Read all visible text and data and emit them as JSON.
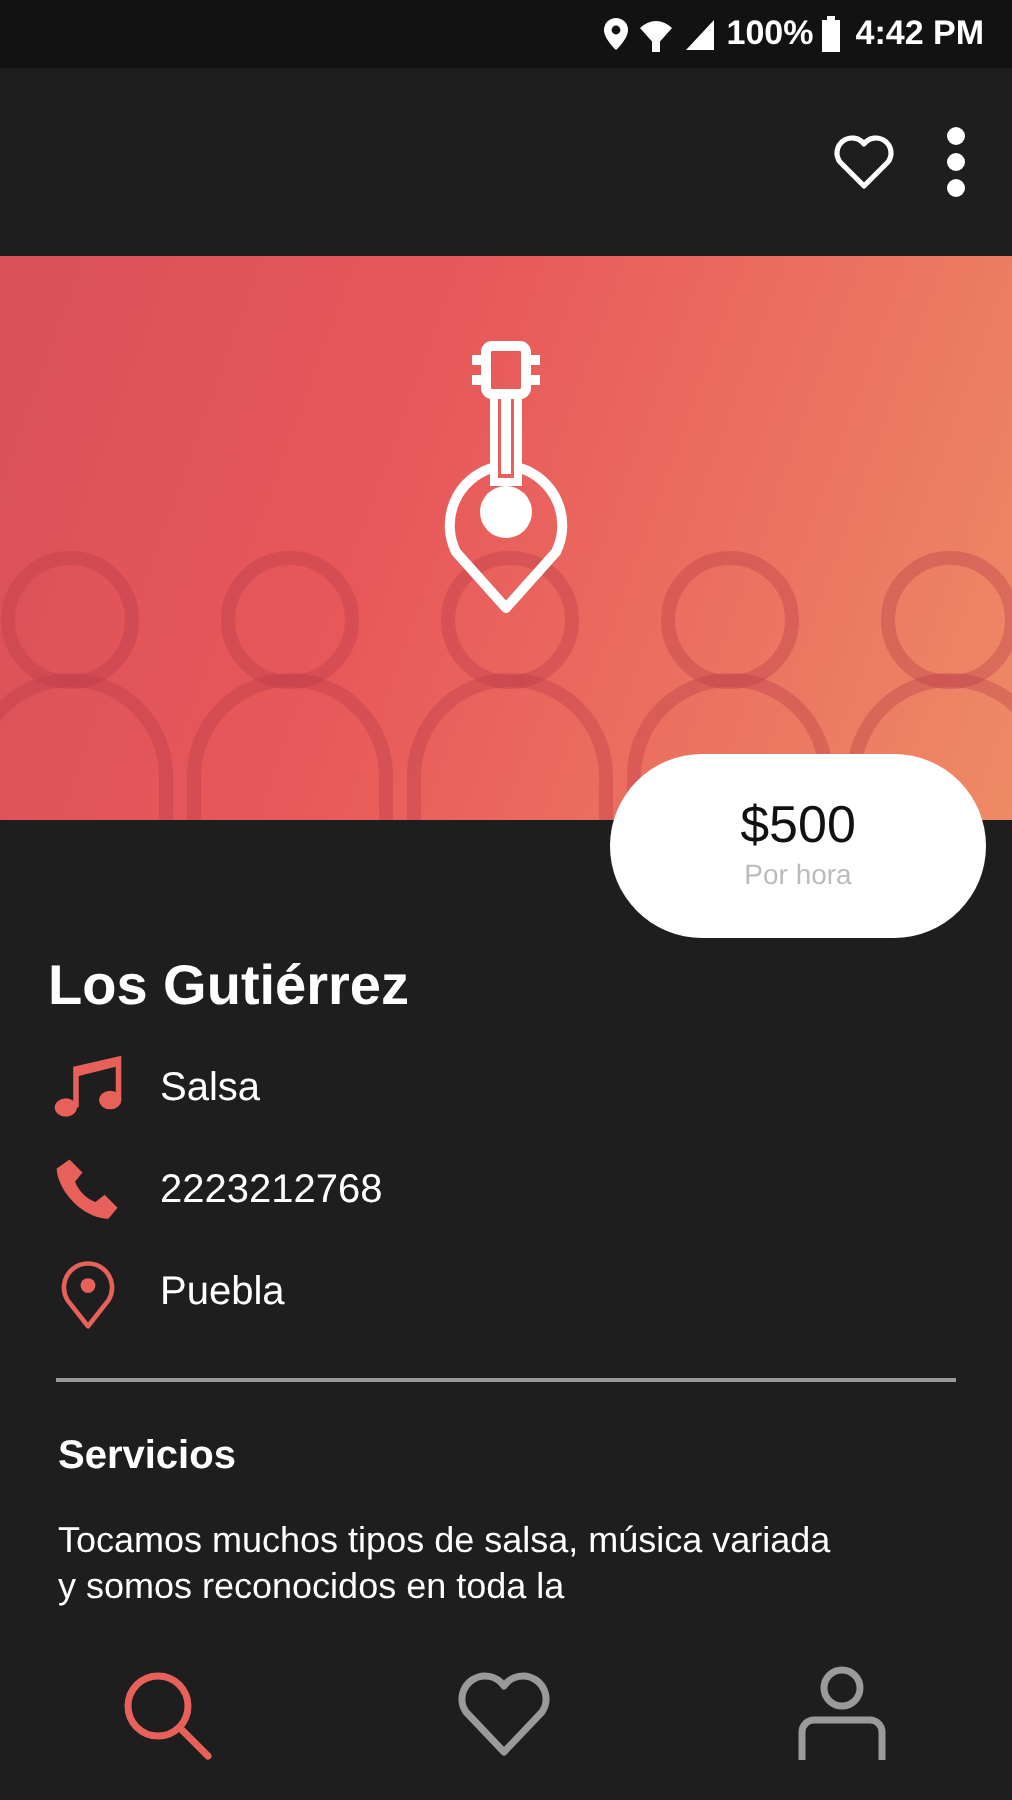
{
  "status_bar": {
    "battery": "100%",
    "time": "4:42 PM"
  },
  "app_bar": {
    "actions": [
      {
        "kind": "favorite"
      },
      {
        "kind": "more"
      }
    ]
  },
  "price": {
    "amount": "$500",
    "unit": "Por hora"
  },
  "name": "Los Gutiérrez",
  "details": [
    {
      "kind": "genre",
      "text": "Salsa"
    },
    {
      "kind": "phone",
      "text": "2223212768"
    },
    {
      "kind": "location",
      "text": "Puebla"
    }
  ],
  "services": {
    "title": "Servicios",
    "text": "Tocamos muchos tipos de salsa, música variada y somos reconocidos en toda la"
  },
  "bottom_nav": [
    {
      "kind": "search",
      "selected": true
    },
    {
      "kind": "favorites",
      "selected": false
    },
    {
      "kind": "profile",
      "selected": false
    }
  ]
}
